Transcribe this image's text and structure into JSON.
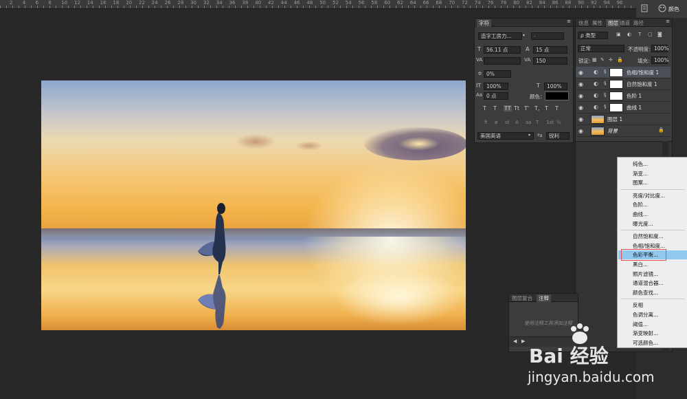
{
  "ruler": {
    "numbers": [
      "2",
      "4",
      "6",
      "8",
      "10",
      "12",
      "14",
      "16",
      "18",
      "20",
      "22",
      "24",
      "26",
      "28",
      "30",
      "32",
      "34",
      "36",
      "38",
      "40",
      "42",
      "44",
      "46",
      "48",
      "50",
      "52",
      "54",
      "56",
      "58",
      "60",
      "62",
      "64",
      "66",
      "68",
      "70",
      "72",
      "74",
      "76",
      "78",
      "80",
      "82",
      "84",
      "86",
      "88",
      "90",
      "92",
      "94",
      "96"
    ]
  },
  "topright": {
    "color_tab": "颜色"
  },
  "char_panel": {
    "tab": "字符",
    "font_family": "造字工房力...",
    "font_style": "-",
    "font_size": "56.11 点",
    "leading": "15 点",
    "kerning": "",
    "tracking": "150",
    "scale_pct": "0%",
    "vscale": "100%",
    "hscale": "100%",
    "baseline": "0 点",
    "color_label": "颜色：",
    "style_buttons": [
      "T",
      "T",
      "TT",
      "Tt",
      "T'",
      "T,",
      "T",
      "T"
    ],
    "ot_buttons": [
      "fi",
      "ø",
      "st",
      "A",
      "aa",
      "T",
      "1st",
      "½"
    ],
    "language": "美国英语",
    "aa_label": "ªa",
    "antialias": "锐利"
  },
  "layers_panel": {
    "tabs": [
      "信息",
      "属性",
      "图层",
      "通道",
      "路径"
    ],
    "active_tab": "图层",
    "filter_kind": "ρ 类型",
    "blend_mode": "正常",
    "opacity_label": "不透明度:",
    "opacity": "100%",
    "lock_label": "锁定:",
    "fill_label": "填充:",
    "fill": "100%",
    "layers": [
      {
        "name": "色相/饱和度 1",
        "type": "adjustment",
        "selected": true
      },
      {
        "name": "自然饱和度 1",
        "type": "adjustment",
        "selected": false
      },
      {
        "name": "色阶 1",
        "type": "adjustment",
        "selected": false
      },
      {
        "name": "曲线 1",
        "type": "adjustment",
        "selected": false
      },
      {
        "name": "图层 1",
        "type": "image",
        "selected": false
      },
      {
        "name": "背景",
        "type": "image",
        "selected": false
      }
    ]
  },
  "comp_panel": {
    "tabs": [
      "图层复合",
      "注释"
    ],
    "active_tab": "注释",
    "hint": "使用注释工具添加注释"
  },
  "menu": {
    "items": [
      "纯色...",
      "渐变...",
      "图案...",
      "亮度/对比度...",
      "色阶...",
      "曲线...",
      "曝光度...",
      "自然饱和度...",
      "色相/饱和度...",
      "色彩平衡...",
      "黑白...",
      "照片滤镜...",
      "通道混合器...",
      "颜色查找...",
      "反相",
      "色调分离...",
      "阈值...",
      "渐变映射...",
      "可选颜色..."
    ],
    "highlighted": "色彩平衡..."
  },
  "watermark": {
    "brand": "Bai 经验",
    "url": "jingyan.baidu.com"
  },
  "colors": {
    "app_bg": "#282828",
    "panel_bg": "#3c3c3c",
    "highlight": "#90c8f0",
    "selected_layer": "#4a4f57"
  }
}
